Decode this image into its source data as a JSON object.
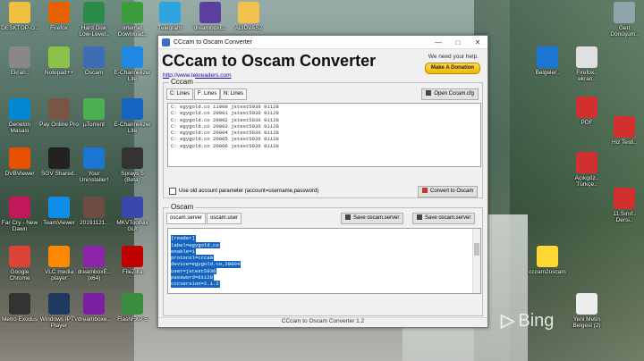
{
  "desktop": {
    "icons": [
      {
        "label": "DESKTOP-G..",
        "color": "#f0c040"
      },
      {
        "label": "Firefox",
        "color": "#e66000"
      },
      {
        "label": "Hard Disk Low-Level..",
        "color": "#2b8c4a"
      },
      {
        "label": "Internet Download..",
        "color": "#3b9c3b"
      },
      {
        "label": "Telegram",
        "color": "#2ca5e0"
      },
      {
        "label": "dreamboxE..",
        "color": "#5a3fa0"
      },
      {
        "label": "ALIDVAS2",
        "color": "#f2c14e"
      },
      {
        "label": "Ekran..",
        "color": "#888888"
      },
      {
        "label": "Notepad++",
        "color": "#8bc34a"
      },
      {
        "label": "Oscam",
        "color": "#3d6db5"
      },
      {
        "label": "E-Channelizer Lite",
        "color": "#1e88e5"
      },
      {
        "label": "Denetim Masası",
        "color": "#0288d1"
      },
      {
        "label": "Pay Online Pro",
        "color": "#795548"
      },
      {
        "label": "µTorrent",
        "color": "#4caf50"
      },
      {
        "label": "E-Channelizer Lite",
        "color": "#1565c0"
      },
      {
        "label": "DVBViewer",
        "color": "#e65100"
      },
      {
        "label": "SGV Shared..",
        "color": "#222222"
      },
      {
        "label": "Your Uninstaller!",
        "color": "#1976d2"
      },
      {
        "label": "Sprays 5 (Beta)",
        "color": "#333333"
      },
      {
        "label": "Far Cry - New Dawn",
        "color": "#c2185b"
      },
      {
        "label": "TeamViewer",
        "color": "#0e8ee9"
      },
      {
        "label": "20191121..",
        "color": "#6d4c41"
      },
      {
        "label": "MKVToolNix GUI",
        "color": "#3949ab"
      },
      {
        "label": "Google Chrome",
        "color": "#db4437"
      },
      {
        "label": "VLC media player",
        "color": "#ff8800"
      },
      {
        "label": "dreamboxE.. (x64)",
        "color": "#8e24aa"
      },
      {
        "label": "FileZilla",
        "color": "#bf0000"
      },
      {
        "label": "Metro Exodus",
        "color": "#333333"
      },
      {
        "label": "Windows IPTV Player",
        "color": "#1e3a5f"
      },
      {
        "label": "dreamboxe..",
        "color": "#7b1fa2"
      },
      {
        "label": "FlashFXP 5",
        "color": "#388e3c"
      },
      {
        "label": "Geri Dönüşüm..",
        "color": "#90a4ae"
      },
      {
        "label": "Belgeler..",
        "color": "#1976d2"
      },
      {
        "label": "Firefox.. ekran..",
        "color": "#e0e0e0"
      },
      {
        "label": "PDF",
        "color": "#d32f2f"
      },
      {
        "label": "Hiz Testi..",
        "color": "#d32f2f"
      },
      {
        "label": "Açıkgöz.. Türkçe..",
        "color": "#d32f2f"
      },
      {
        "label": "11.Sınıf.. Dersi..",
        "color": "#d32f2f"
      },
      {
        "label": "cccam2oscam",
        "color": "#fdd835"
      },
      {
        "label": "Yeni Metin Belgesi (2)",
        "color": "#eeeeee"
      }
    ],
    "bing": "Bing"
  },
  "window": {
    "title": "CCcam to Oscam Converter",
    "app_title": "CCcam to Oscam Converter",
    "app_link": "http://www.tekreaders.com",
    "we_need": "We need your help.",
    "donate_label": "Make A Donation",
    "cccam_group_label": "Cccam",
    "cccam_tabs": [
      "C: Lines",
      "F: Lines",
      "N: Lines"
    ],
    "open_cccam_label": "Open Cccam.cfg",
    "cccam_lines": [
      "C: egygold.co 11000 jstest5936 91128",
      "C: egygold.co 20001 jstest5936 91128",
      "C: egygold.co 20002 jstest5936 91128",
      "C: egygold.co 20003 jstest5936 91128",
      "C: egygold.co 20004 jstest5936 91128",
      "C: egygold.co 20005 jstest5936 91128",
      "C: egygold.co 20006 jstest5936 91128"
    ],
    "use_old_label": "Use old account parameter (account=username,password)",
    "convert_label": "Convert to Oscam",
    "oscam_group_label": "Oscam",
    "oscam_tabs": [
      "oscam.server",
      "oscam.user"
    ],
    "save_server_label": "Save oscam.server",
    "save_user_label": "Save oscam.server",
    "oscam_lines": [
      "",
      "[reader]",
      "label=egygold.co",
      "enable=1",
      "protocol=cccam",
      "device=egygold.co,20004",
      "user=jstest5936",
      "password=91128",
      "cccversion=2.1.2"
    ],
    "status": "CCcam to Oscam Converter 1.2"
  }
}
